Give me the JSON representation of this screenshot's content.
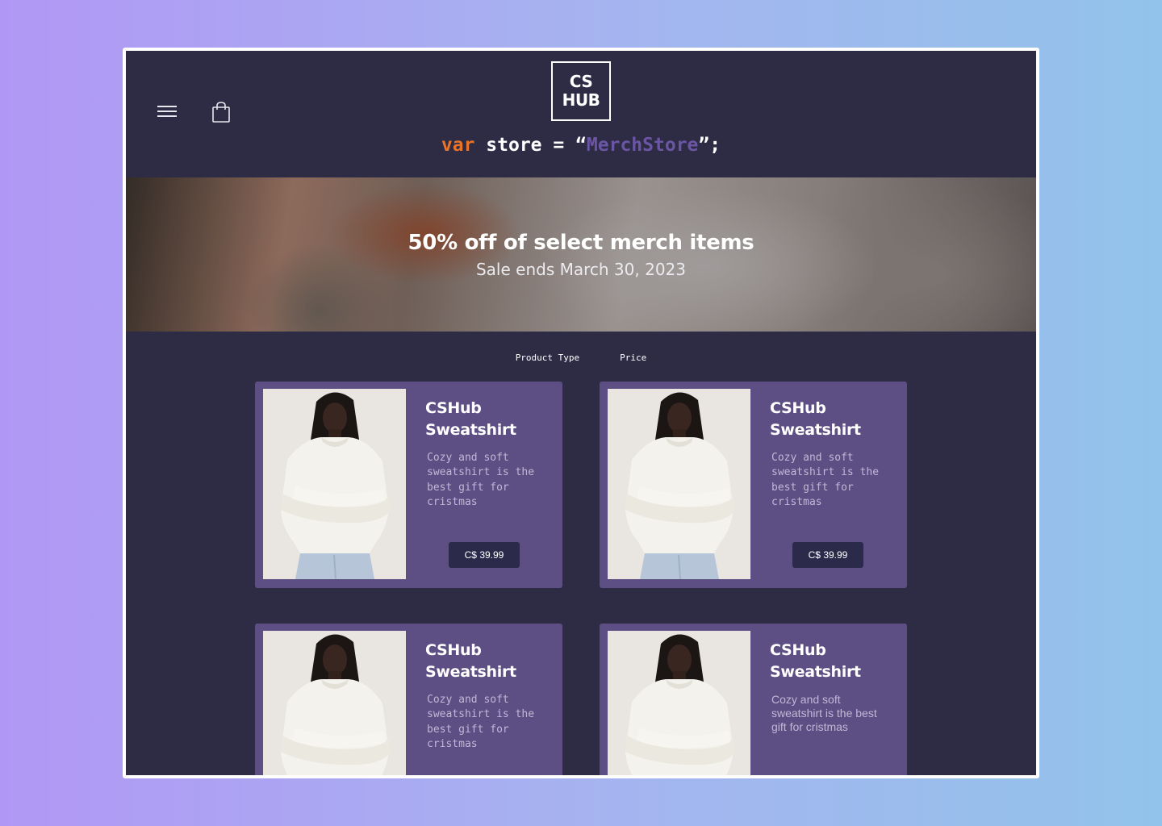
{
  "header": {
    "logo_line1": "CS",
    "logo_line2": "HUB",
    "code": {
      "keyword": "var",
      "identifier": " store = “",
      "string": "MerchStore",
      "end": "”;"
    },
    "menu_icon": "hamburger-menu-icon",
    "bag_icon": "shopping-bag-icon"
  },
  "banner": {
    "title": "50% off of select merch items",
    "subtitle": "Sale ends March 30, 2023"
  },
  "filters": {
    "product_type": "Product Type",
    "price": "Price"
  },
  "products": [
    {
      "title_line1": "CSHub",
      "title_line2": "Sweatshirt",
      "description": "Cozy and soft sweatshirt is the best gift for cristmas",
      "price": "C$ 39.99"
    },
    {
      "title_line1": "CSHub",
      "title_line2": "Sweatshirt",
      "description": "Cozy and soft sweatshirt is the best gift for cristmas",
      "price": "C$ 39.99"
    },
    {
      "title_line1": "CSHub",
      "title_line2": "Sweatshirt",
      "description": "Cozy and soft sweatshirt is the best gift for cristmas",
      "price": ""
    },
    {
      "title_line1": "CSHub",
      "title_line2": "Sweatshirt",
      "description": "Cozy and soft sweatshirt is the best gift for cristmas",
      "price": ""
    }
  ],
  "colors": {
    "page_bg": "#2e2b45",
    "card_bg": "#5d4e84",
    "button_bg": "#2c2a4b",
    "keyword": "#e8742a",
    "string": "#6b56a6"
  }
}
